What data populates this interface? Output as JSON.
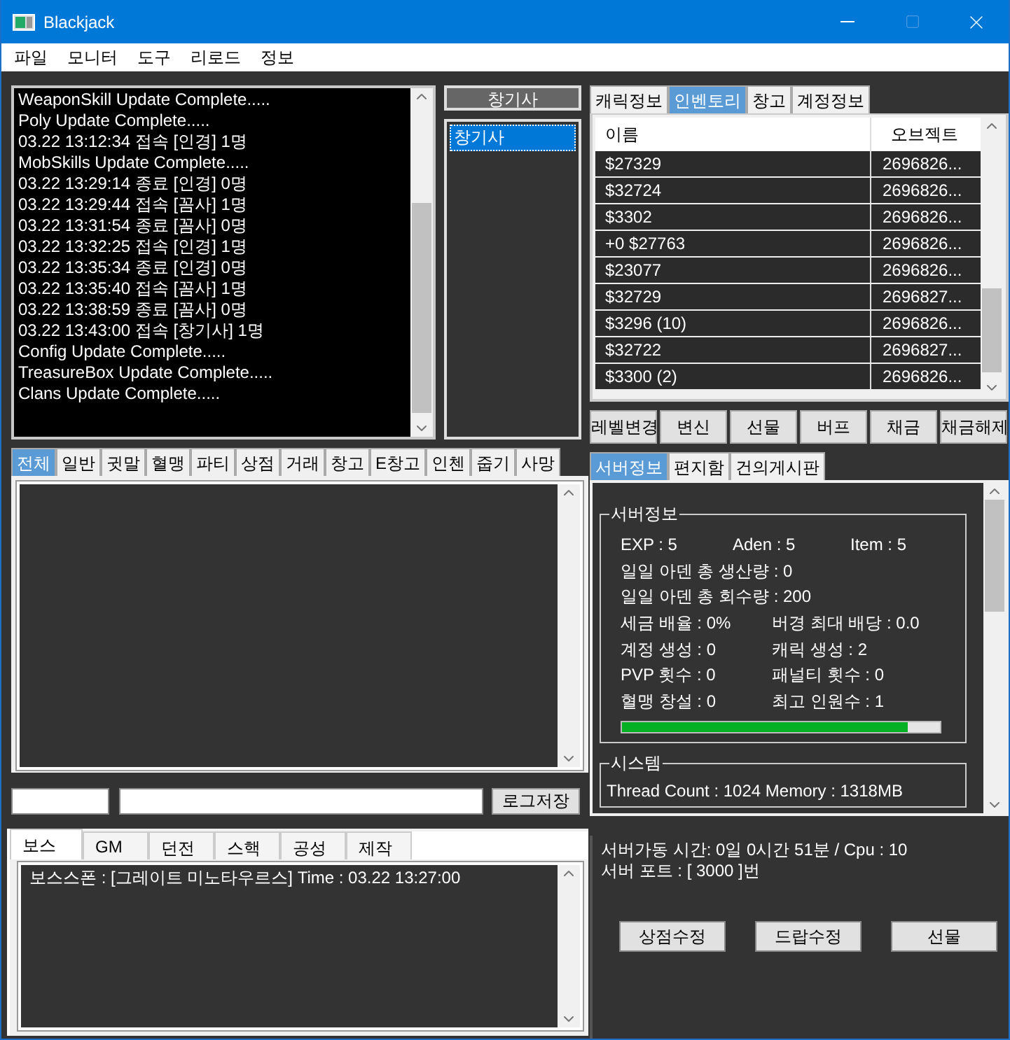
{
  "window": {
    "title": "Blackjack"
  },
  "menu": [
    "파일",
    "모니터",
    "도구",
    "리로드",
    "정보"
  ],
  "log": [
    "WeaponSkill Update Complete.....",
    "Poly Update Complete.....",
    "03.22 13:12:34 접속 [인경] 1명",
    "MobSkills Update Complete.....",
    "03.22 13:29:14 종료 [인경] 0명",
    "03.22 13:29:44 접속 [꼼사] 1명",
    "03.22 13:31:54 종료 [꼼사] 0명",
    "03.22 13:32:25 접속 [인경] 1명",
    "03.22 13:35:34 종료 [인경] 0명",
    "03.22 13:35:40 접속 [꼼사] 1명",
    "03.22 13:38:59 종료 [꼼사] 0명",
    "03.22 13:43:00 접속 [창기사] 1명",
    "Config Update Complete.....",
    "TreasureBox Update Complete.....",
    "Clans Update Complete....."
  ],
  "class_button": "창기사",
  "class_list": [
    {
      "label": "창기사",
      "selected": true
    }
  ],
  "chat_tabs": [
    {
      "label": "전체",
      "selected": true
    },
    {
      "label": "일반",
      "selected": false
    },
    {
      "label": "귓말",
      "selected": false
    },
    {
      "label": "혈맹",
      "selected": false
    },
    {
      "label": "파티",
      "selected": false
    },
    {
      "label": "상점",
      "selected": false
    },
    {
      "label": "거래",
      "selected": false
    },
    {
      "label": "창고",
      "selected": false
    },
    {
      "label": "E창고",
      "selected": false
    },
    {
      "label": "인첸",
      "selected": false
    },
    {
      "label": "줍기",
      "selected": false
    },
    {
      "label": "사망",
      "selected": false
    }
  ],
  "log_save_button": "로그저장",
  "bottom_tabs": [
    {
      "label": "보스",
      "selected": true
    },
    {
      "label": "GM",
      "selected": false
    },
    {
      "label": "던전",
      "selected": false
    },
    {
      "label": "스핵",
      "selected": false
    },
    {
      "label": "공성",
      "selected": false
    },
    {
      "label": "제작",
      "selected": false
    }
  ],
  "boss_log": [
    "보스스폰 : [그레이트 미노타우르스]  Time : 03.22 13:27:00"
  ],
  "char_tabs": [
    {
      "label": "캐릭정보",
      "selected": false
    },
    {
      "label": "인벤토리",
      "selected": true
    },
    {
      "label": "창고",
      "selected": false
    },
    {
      "label": "계정정보",
      "selected": false
    }
  ],
  "inventory": {
    "columns": [
      "이름",
      "오브젝트"
    ],
    "rows": [
      {
        "name": "$27329",
        "object": "2696826..."
      },
      {
        "name": "$32724",
        "object": "2696826..."
      },
      {
        "name": "$3302",
        "object": "2696826..."
      },
      {
        "name": "+0 $27763",
        "object": "2696826..."
      },
      {
        "name": "$23077",
        "object": "2696826..."
      },
      {
        "name": "$32729",
        "object": "2696827..."
      },
      {
        "name": "$3296  (10)",
        "object": "2696826..."
      },
      {
        "name": "$32722",
        "object": "2696827..."
      },
      {
        "name": "$3300  (2)",
        "object": "2696826..."
      }
    ]
  },
  "action_buttons": [
    "레벨변경",
    "변신",
    "선물",
    "버프",
    "채금",
    "채금해제"
  ],
  "server_tabs": [
    {
      "label": "서버정보",
      "selected": true
    },
    {
      "label": "편지함",
      "selected": false
    },
    {
      "label": "건의게시판",
      "selected": false
    }
  ],
  "server_info": {
    "title": "서버정보",
    "rows": [
      [
        "EXP : 5",
        "Aden : 5",
        "Item : 5"
      ],
      [
        "일일 아덴 총 생산량 :  0"
      ],
      [
        "일일 아덴 총 회수량 :  200"
      ],
      [
        "세금 배율 :  0%",
        "버경 최대 배당 : 0.0"
      ],
      [
        "계정 생성 :  0",
        "캐릭 생성 : 2"
      ],
      [
        " PVP 횟수 : 0",
        "패널티 횟수 :  0"
      ],
      [
        "혈맹 창설 :  0",
        "최고 인원수 :  1"
      ]
    ],
    "level": 0.9
  },
  "system": {
    "title": "시스템",
    "text": "Thread Count : 1024   Memory : 1318MB"
  },
  "status": [
    "서버가동 시간:  0일 0시간 51분 / Cpu : 10",
    "서버 포트  : [ 3000 ]번"
  ],
  "bottom_buttons": [
    "상점수정",
    "드랍수정",
    "선물"
  ]
}
